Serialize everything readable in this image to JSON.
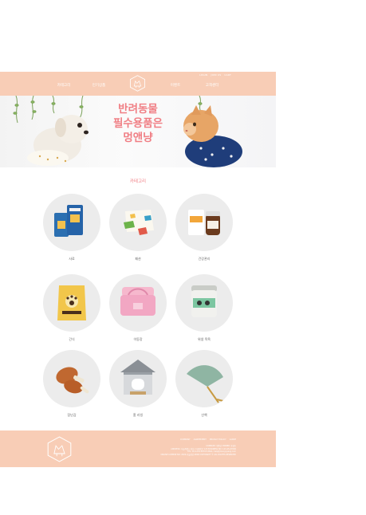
{
  "header": {
    "top_links": [
      "LOGIN",
      "JOIN US",
      "CART"
    ],
    "nav": [
      "카테고리",
      "인기상품",
      "이벤트",
      "고객센터"
    ],
    "logo_icon": "hexagon-cat-logo-icon"
  },
  "hero": {
    "title_lines": [
      "반려동물",
      "필수용품은",
      "멍앤냥"
    ]
  },
  "categories": {
    "title": "카테고리",
    "items": [
      {
        "label": "사료",
        "icon": "pet-food-bags"
      },
      {
        "label": "패션",
        "icon": "pet-clothing"
      },
      {
        "label": "건강관리",
        "icon": "supplement-jar"
      },
      {
        "label": "간식",
        "icon": "treat-pouch"
      },
      {
        "label": "이동장",
        "icon": "pet-carrier-bag"
      },
      {
        "label": "위생 목욕",
        "icon": "hygiene-tub"
      },
      {
        "label": "장난감",
        "icon": "chicken-leg-toy"
      },
      {
        "label": "홈 리빙",
        "icon": "pet-house"
      },
      {
        "label": "산책",
        "icon": "walking-umbrella"
      }
    ]
  },
  "footer": {
    "links": [
      "COMPANY",
      "AGREEMENT",
      "PRIVACY POLICY",
      "GUIDE"
    ],
    "info_lines": [
      "COMPANY: 멍앤냥 OWNER: 홍길동",
      "ADDRESS: 서울특별시 강남구 테헤란로 123 BUSINESS NO: 123-45-67890",
      "TEL: 02-1234-5678 E-MAIL: help@mungnyang.com",
      "ONLINE LICENSE NO: 2024-서울강남-0000 COPYRIGHT © ALL RIGHTS RESERVED"
    ]
  },
  "colors": {
    "accent": "#f07e84",
    "peach": "#f8cdb6",
    "circle": "#ececec"
  }
}
